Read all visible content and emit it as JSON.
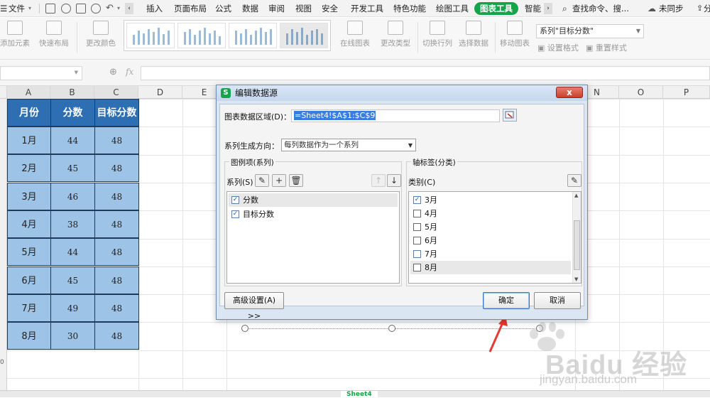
{
  "menu": {
    "file": "文件",
    "tabs": [
      "插入",
      "页面布局",
      "公式",
      "数据",
      "审阅",
      "视图",
      "安全",
      "开发工具",
      "特色功能",
      "绘图工具",
      "图表工具",
      "智能"
    ],
    "active_tab": "图表工具",
    "search": "查找命令、搜...",
    "sync": "未同步",
    "share": "分"
  },
  "ribbon": {
    "add_element": "添加元素",
    "quick_layout": "快速布局",
    "change_color": "更改颜色",
    "online_chart": "在线图表",
    "change_type": "更改类型",
    "switch_row_col": "切换行列",
    "select_data": "选择数据",
    "move_chart": "移动图表",
    "set_format": "设置格式",
    "reset_style": "重置样式",
    "series_select": "系列\"目标分数\""
  },
  "formula": {
    "fx": "fx"
  },
  "columns": [
    "A",
    "B",
    "C",
    "D",
    "E",
    "N",
    "O",
    "P"
  ],
  "table": {
    "headers": [
      "月份",
      "分数",
      "目标分数"
    ],
    "rows": [
      [
        "1月",
        "44",
        "48"
      ],
      [
        "2月",
        "45",
        "48"
      ],
      [
        "3月",
        "46",
        "48"
      ],
      [
        "4月",
        "38",
        "48"
      ],
      [
        "5月",
        "44",
        "48"
      ],
      [
        "6月",
        "45",
        "48"
      ],
      [
        "7月",
        "49",
        "48"
      ],
      [
        "8月",
        "30",
        "48"
      ]
    ]
  },
  "dialog": {
    "title": "编辑数据源",
    "logo": "S",
    "close": "x",
    "range_label": "图表数据区域(D)：",
    "range_value": "=Sheet4!$A$1:$C$9",
    "direction_label": "系列生成方向：",
    "direction_value": "每列数据作为一个系列",
    "legend_group": "图例项(系列)",
    "series_label": "系列(S)",
    "series_items": [
      {
        "label": "分数",
        "checked": true
      },
      {
        "label": "目标分数",
        "checked": true
      }
    ],
    "axis_group": "轴标签(分类)",
    "category_label": "类别(C)",
    "category_items": [
      {
        "label": "3月",
        "checked": true
      },
      {
        "label": "4月",
        "checked": false
      },
      {
        "label": "5月",
        "checked": false
      },
      {
        "label": "6月",
        "checked": false
      },
      {
        "label": "7月",
        "checked": false
      },
      {
        "label": "8月",
        "checked": false
      }
    ],
    "advanced": "高级设置(A) >>",
    "ok": "确定",
    "cancel": "取消"
  },
  "sheet_tabs": {
    "active": "Sheet4"
  },
  "watermark": {
    "main": "Baidu 经验",
    "sub": "jingyan.baidu.com"
  },
  "colors": {
    "accent_green": "#17a34a",
    "header_blue": "#2e6fb3",
    "cell_blue": "#9dc3e6",
    "annotation_red": "#e53935"
  }
}
